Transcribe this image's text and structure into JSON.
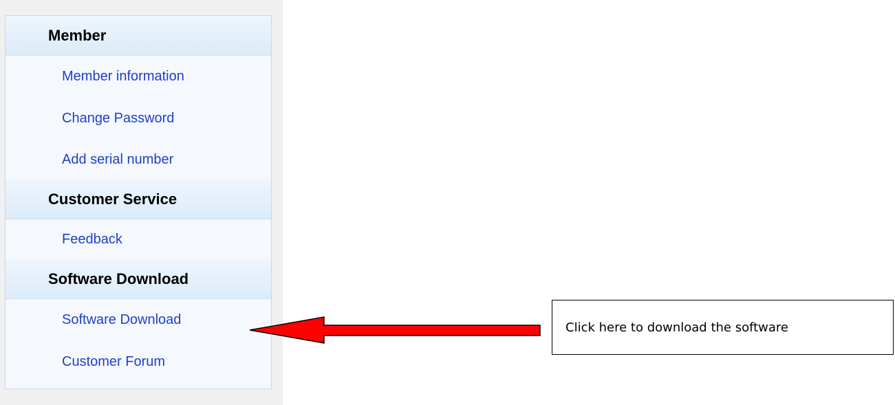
{
  "menu": {
    "sections": [
      {
        "title": "Member",
        "items": [
          "Member information",
          "Change Password",
          "Add serial number"
        ]
      },
      {
        "title": "Customer Service",
        "items": [
          "Feedback"
        ]
      },
      {
        "title": "Software Download",
        "items": [
          "Software Download",
          "Customer Forum"
        ]
      }
    ]
  },
  "annotation": {
    "text": "Click here to download the software",
    "arrow_color": "#ff0000",
    "arrow_outline": "#000000",
    "points_to": "Software Download"
  },
  "colors": {
    "link": "#1f3fc7",
    "menu_background": "#f5f8fd",
    "header_gradient_top": "#eef5fd",
    "header_gradient_bottom": "#dcebf9"
  }
}
